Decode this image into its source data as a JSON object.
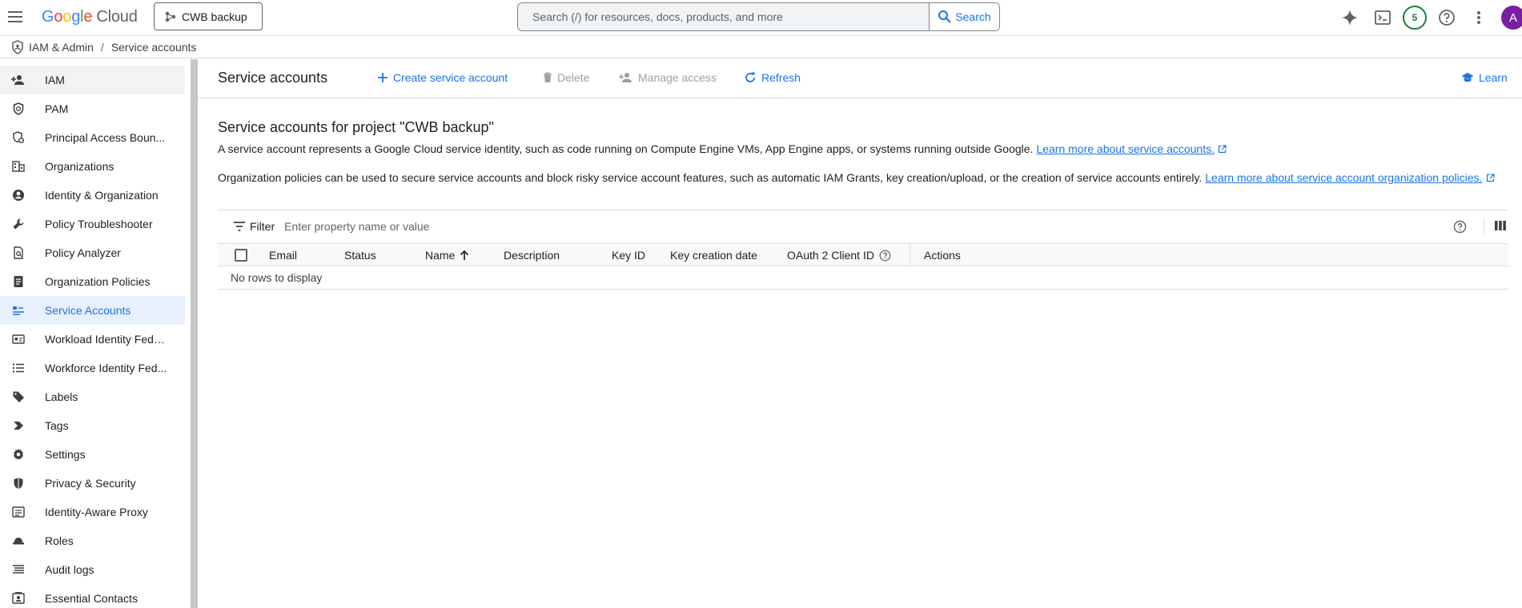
{
  "header": {
    "logo_google": "Google",
    "logo_cloud": "Cloud",
    "project_name": "CWB backup",
    "search_placeholder": "Search (/) for resources, docs, products, and more",
    "search_button": "Search",
    "notification_count": "5",
    "avatar_initial": "A"
  },
  "breadcrumb": {
    "root": "IAM & Admin",
    "separator": "/",
    "current": "Service accounts"
  },
  "sidebar": {
    "items": [
      {
        "label": "IAM",
        "icon": "person-add-icon"
      },
      {
        "label": "PAM",
        "icon": "shield-clock-icon"
      },
      {
        "label": "Principal Access Boun...",
        "icon": "policy-boundary-icon"
      },
      {
        "label": "Organizations",
        "icon": "building-icon"
      },
      {
        "label": "Identity & Organization",
        "icon": "account-circle-icon"
      },
      {
        "label": "Policy Troubleshooter",
        "icon": "wrench-icon"
      },
      {
        "label": "Policy Analyzer",
        "icon": "analyzer-icon"
      },
      {
        "label": "Organization Policies",
        "icon": "document-icon"
      },
      {
        "label": "Service Accounts",
        "icon": "service-account-icon"
      },
      {
        "label": "Workload Identity Fede...",
        "icon": "id-card-icon"
      },
      {
        "label": "Workforce Identity Fed...",
        "icon": "list-icon"
      },
      {
        "label": "Labels",
        "icon": "tag-icon"
      },
      {
        "label": "Tags",
        "icon": "label-arrow-icon"
      },
      {
        "label": "Settings",
        "icon": "gear-icon"
      },
      {
        "label": "Privacy & Security",
        "icon": "shield-icon"
      },
      {
        "label": "Identity-Aware Proxy",
        "icon": "proxy-icon"
      },
      {
        "label": "Roles",
        "icon": "hat-icon"
      },
      {
        "label": "Audit logs",
        "icon": "logs-icon"
      },
      {
        "label": "Essential Contacts",
        "icon": "contacts-icon"
      }
    ],
    "active_index": 8
  },
  "toolbar": {
    "title": "Service accounts",
    "create": "Create service account",
    "delete": "Delete",
    "manage_access": "Manage access",
    "refresh": "Refresh",
    "learn": "Learn"
  },
  "content": {
    "section_title": "Service accounts for project \"CWB backup\"",
    "para1_text": "A service account represents a Google Cloud service identity, such as code running on Compute Engine VMs, App Engine apps, or systems running outside Google.",
    "para1_link": "Learn more about service accounts.",
    "para2_text": "Organization policies can be used to secure service accounts and block risky service account features, such as automatic IAM Grants, key creation/upload, or the creation of service accounts entirely.",
    "para2_link": "Learn more about service account organization policies."
  },
  "filter": {
    "label": "Filter",
    "placeholder": "Enter property name or value"
  },
  "table": {
    "columns": [
      "Email",
      "Status",
      "Name",
      "Description",
      "Key ID",
      "Key creation date",
      "OAuth 2 Client ID",
      "Actions"
    ],
    "sorted_column": "Name",
    "empty_text": "No rows to display"
  },
  "colors": {
    "accent": "#1a73e8",
    "active_bg": "#e8f0fe",
    "notif_green": "#188038",
    "avatar_purple": "#7b1fa2"
  }
}
